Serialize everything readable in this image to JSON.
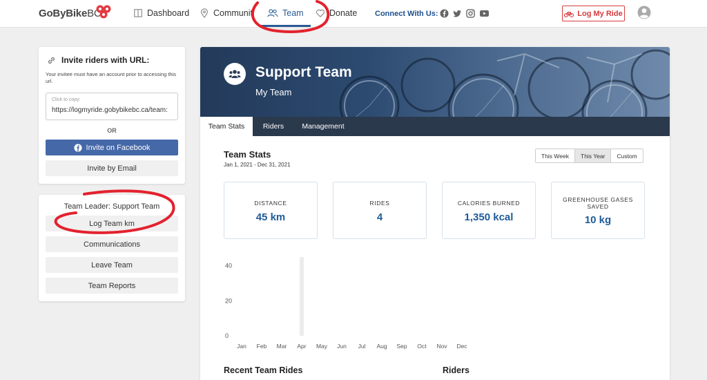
{
  "nav": {
    "logo_bold": "GoByBike",
    "logo_light": "BC",
    "dashboard": "Dashboard",
    "community": "Communit",
    "team": "Team",
    "donate": "Donate",
    "connect": "Connect With Us:",
    "log_my_ride": "Log My Ride",
    "brand_color": "#2a5a96",
    "accent_red": "#d63a3a"
  },
  "invite": {
    "title": "Invite riders with URL:",
    "note": "Your invitee must have an account prior to accessing this url.",
    "copy_label": "Click to copy:",
    "url": "https://logmyride.gobybikebc.ca/team:",
    "or": "OR",
    "facebook": "Invite on Facebook",
    "email": "Invite by Email"
  },
  "team_actions": {
    "leader": "Team Leader: Support Team",
    "log_km": "Log Team km",
    "communications": "Communications",
    "leave": "Leave Team",
    "reports": "Team Reports"
  },
  "hero": {
    "title": "Support Team",
    "subtitle": "My Team"
  },
  "tabs": [
    "Team Stats",
    "Riders",
    "Management"
  ],
  "stats": {
    "title": "Team Stats",
    "range": "Jan 1, 2021 - Dec 31, 2021",
    "periods": [
      "This Week",
      "This Year",
      "Custom"
    ],
    "selected_period": "This Year",
    "boxes": [
      {
        "label": "DISTANCE",
        "value": "45 km"
      },
      {
        "label": "RIDES",
        "value": "4"
      },
      {
        "label": "CALORIES BURNED",
        "value": "1,350 kcal"
      },
      {
        "label": "GREENHOUSE GASES SAVED",
        "value": "10 kg"
      }
    ]
  },
  "chart_data": {
    "type": "bar",
    "categories": [
      "Jan",
      "Feb",
      "Mar",
      "Apr",
      "May",
      "Jun",
      "Jul",
      "Aug",
      "Sep",
      "Oct",
      "Nov",
      "Dec"
    ],
    "values": [
      0,
      0,
      0,
      45,
      0,
      0,
      0,
      0,
      0,
      0,
      0,
      0
    ],
    "yticks": [
      "0",
      "20",
      "40"
    ],
    "ylim": [
      0,
      45
    ],
    "bar_color": "#ececec",
    "grid": false
  },
  "sections": {
    "recent_rides": "Recent Team Rides",
    "riders": "Riders"
  }
}
